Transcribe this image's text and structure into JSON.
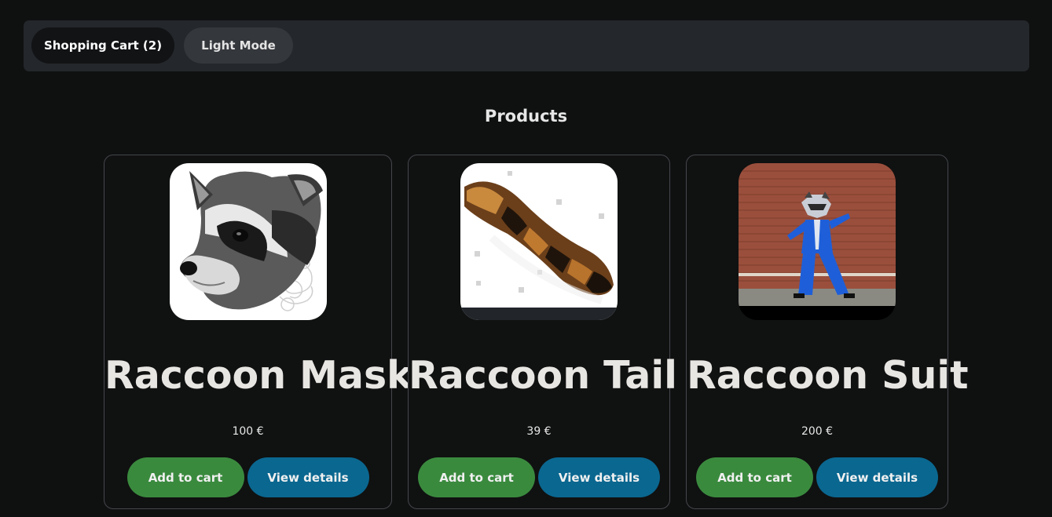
{
  "nav": {
    "cart_label": "Shopping Cart (2)",
    "mode_label": "Light Mode"
  },
  "section": {
    "title": "Products"
  },
  "products": [
    {
      "name": "Raccoon Mask",
      "price": "100 €",
      "add_label": "Add to cart",
      "view_label": "View details",
      "image": "raccoon-mask-image"
    },
    {
      "name": "Raccoon Tail",
      "price": "39 €",
      "add_label": "Add to cart",
      "view_label": "View details",
      "image": "raccoon-tail-image"
    },
    {
      "name": "Raccoon Suit",
      "price": "200 €",
      "add_label": "Add to cart",
      "view_label": "View details",
      "image": "raccoon-suit-image"
    }
  ],
  "colors": {
    "background": "#0f1111",
    "add_button": "#3a8a3e",
    "view_button": "#0a6790"
  }
}
